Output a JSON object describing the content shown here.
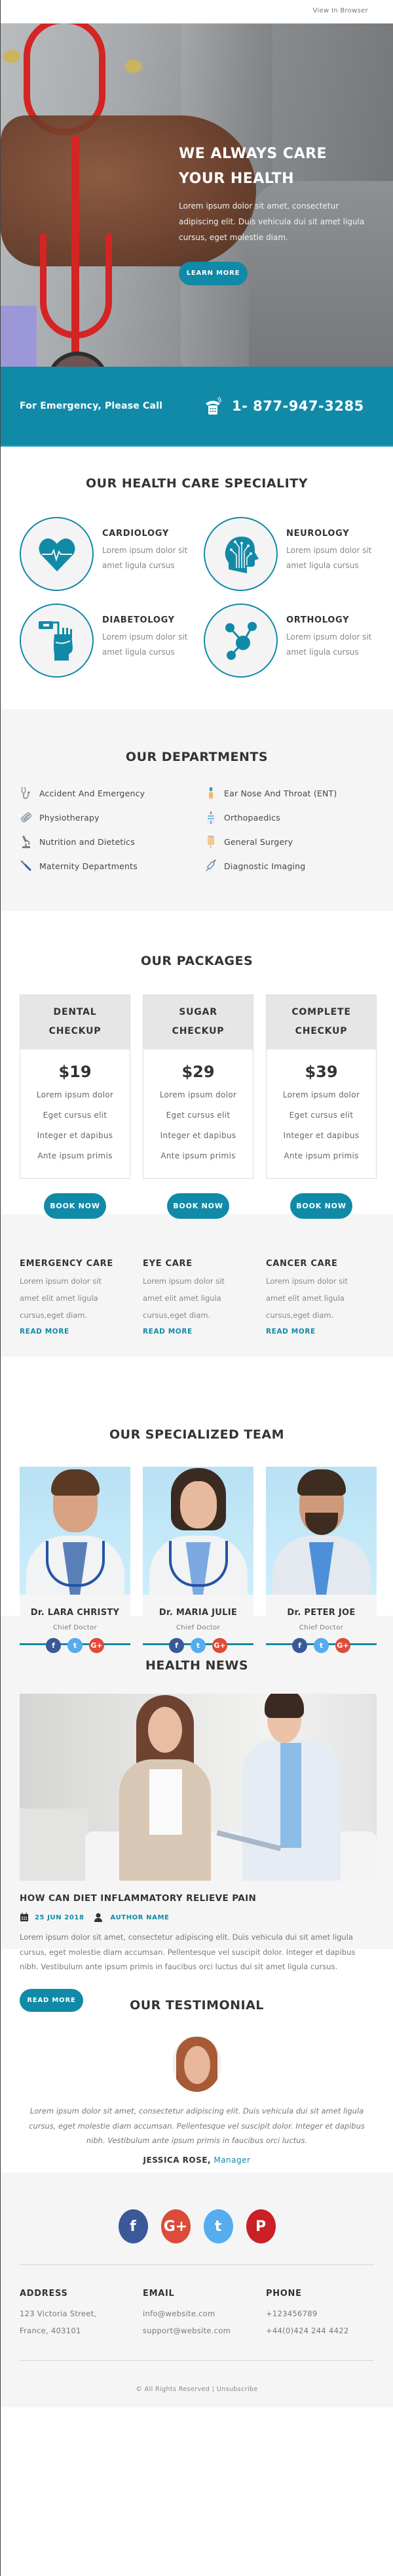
{
  "colors": {
    "accent": "#118aa8",
    "light_bg": "#f5f5f5",
    "facebook": "#3b5998",
    "twitter": "#55acee",
    "google_plus": "#dd4b39",
    "pinterest": "#cb2027"
  },
  "header": {
    "view_in_browser": "View In Browser"
  },
  "hero": {
    "title_line1": "WE ALWAYS CARE",
    "title_line2": "YOUR HEALTH",
    "text": "Lorem ipsum dolor sit amet, consectetur adipiscing elit. Duis vehicula dui sit amet ligula cursus, eget molestie diam.",
    "button": "LEARN MORE"
  },
  "emergency": {
    "label": "For Emergency, Please Call",
    "icon": "phone-icon",
    "phone": "1- 877-947-3285"
  },
  "speciality": {
    "title": "OUR HEALTH CARE SPECIALITY",
    "items": [
      {
        "name": "CARDIOLOGY",
        "desc": "Lorem ipsum dolor sit amet ligula cursus",
        "icon": "heart-pulse-icon"
      },
      {
        "name": "NEUROLOGY",
        "desc": "Lorem ipsum dolor sit amet ligula cursus",
        "icon": "brain-circuit-icon"
      },
      {
        "name": "DIABETOLOGY",
        "desc": "Lorem ipsum dolor sit amet ligula cursus",
        "icon": "glucose-finger-icon"
      },
      {
        "name": "ORTHOLOGY",
        "desc": "Lorem ipsum dolor sit amet ligula cursus",
        "icon": "molecule-icon"
      }
    ]
  },
  "departments": {
    "title": "OUR DEPARTMENTS",
    "items": [
      {
        "label": "Accident And Emergency",
        "icon": "stethoscope-icon"
      },
      {
        "label": "Ear Nose And Throat (ENT)",
        "icon": "dropper-bottle-icon"
      },
      {
        "label": "Physiotherapy",
        "icon": "pill-pack-icon"
      },
      {
        "label": "Orthopaedics",
        "icon": "hospital-building-icon"
      },
      {
        "label": "Nutrition and Dietetics",
        "icon": "microscope-icon"
      },
      {
        "label": "General Surgery",
        "icon": "iv-bag-icon"
      },
      {
        "label": "Maternity Departments",
        "icon": "thermometer-icon"
      },
      {
        "label": "Diagnostic Imaging",
        "icon": "syringe-icon"
      }
    ]
  },
  "packages": {
    "title": "OUR PACKAGES",
    "items": [
      {
        "name_line1": "DENTAL",
        "name_line2": "CHECKUP",
        "price": "$19",
        "features": [
          "Lorem ipsum dolor",
          "Eget cursus elit",
          "Integer et dapibus",
          "Ante ipsum primis"
        ],
        "button": "BOOK NOW"
      },
      {
        "name_line1": "SUGAR",
        "name_line2": "CHECKUP",
        "price": "$29",
        "features": [
          "Lorem ipsum dolor",
          "Eget cursus elit",
          "Integer et dapibus",
          "Ante ipsum primis"
        ],
        "button": "BOOK NOW"
      },
      {
        "name_line1": "COMPLETE",
        "name_line2": "CHECKUP",
        "price": "$39",
        "features": [
          "Lorem ipsum dolor",
          "Eget cursus elit",
          "Integer et dapibus",
          "Ante ipsum primis"
        ],
        "button": "BOOK NOW"
      }
    ]
  },
  "care": {
    "items": [
      {
        "title": "EMERGENCY CARE",
        "desc": "Lorem ipsum dolor sit amet elit amet ligula cursus,eget diam.",
        "link": "READ MORE"
      },
      {
        "title": "EYE CARE",
        "desc": "Lorem ipsum dolor sit amet elit amet ligula cursus,eget diam.",
        "link": "READ MORE"
      },
      {
        "title": "CANCER CARE",
        "desc": "Lorem ipsum dolor sit amet elit amet ligula cursus,eget diam.",
        "link": "READ MORE"
      }
    ]
  },
  "team": {
    "title": "OUR SPECIALIZED TEAM",
    "members": [
      {
        "name": "Dr. LARA CHRISTY",
        "role": "Chief Doctor"
      },
      {
        "name": "Dr. MARIA JULIE",
        "role": "Chief Doctor"
      },
      {
        "name": "Dr. PETER JOE",
        "role": "Chief Doctor"
      }
    ],
    "social": {
      "facebook": "f",
      "twitter": "t",
      "google_plus": "G+"
    }
  },
  "news": {
    "title": "HEALTH NEWS",
    "article_title": "HOW CAN DIET INFLAMMATORY RELIEVE PAIN",
    "date": "25 JUN 2018",
    "author": "AUTHOR NAME",
    "text": "Lorem ipsum dolor sit amet, consectetur adipiscing elit. Duis vehicula dui sit amet ligula cursus, eget molestie diam accumsan. Pellentesque vel suscipit dolor. Integer et dapibus nibh. Vestibulum ante ipsum primis in faucibus orci luctus dui sit amet ligula cursus.",
    "button": "READ MORE"
  },
  "testimonial": {
    "title": "OUR TESTIMONIAL",
    "quote": "Lorem ipsum dolor sit amet, consectetur adipiscing elit. Duis vehicula dui sit amet ligula cursus, eget molestie diam accumsan. Pellentesque vel suscipit dolor. Integer et dapibus nibh. Vestibulum ante ipsum primis in faucibus orci luctus.",
    "author_name": "JESSICA ROSE,",
    "author_role": "Manager"
  },
  "footer": {
    "social": {
      "facebook": "f",
      "google_plus": "G+",
      "twitter": "t",
      "pinterest": "P"
    },
    "address_title": "ADDRESS",
    "address_line1": "123 Victoria Street,",
    "address_line2": "France, 403101",
    "email_title": "EMAIL",
    "email_line1": "info@website.com",
    "email_line2": "support@website.com",
    "phone_title": "PHONE",
    "phone_line1": "+123456789",
    "phone_line2": "+44(0)424 244 4422",
    "copyright": "© All Rights Reserved |",
    "unsubscribe": "Unsubscribe"
  }
}
